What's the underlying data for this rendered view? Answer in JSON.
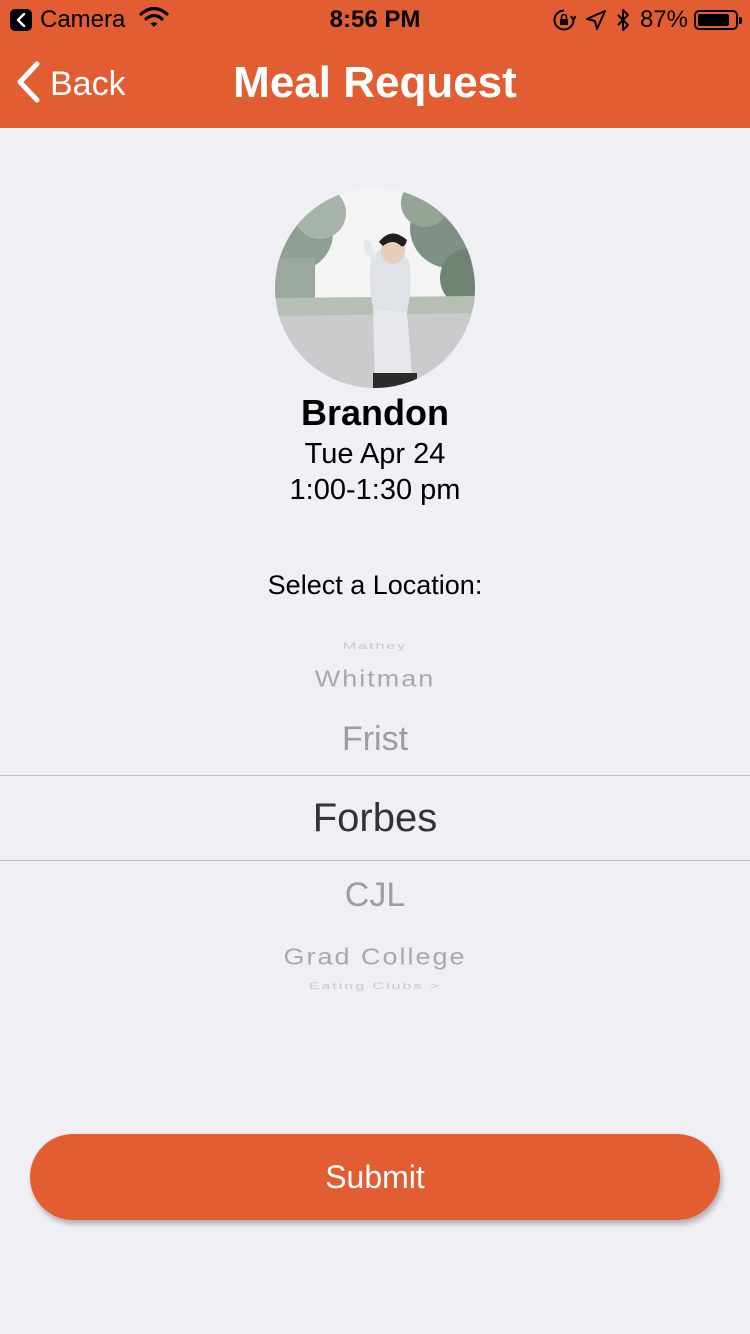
{
  "status_bar": {
    "back_app": "Camera",
    "time": "8:56 PM",
    "battery_percent": "87%",
    "battery_level": 0.87,
    "icons": [
      "wifi-icon",
      "orientation-lock-icon",
      "location-arrow-icon",
      "bluetooth-icon",
      "battery-icon"
    ]
  },
  "nav": {
    "back_label": "Back",
    "title": "Meal Request"
  },
  "profile": {
    "name": "Brandon",
    "date": "Tue Apr 24",
    "time": "1:00-1:30 pm"
  },
  "location": {
    "label": "Select a Location:",
    "options": [
      "Mathey",
      "Whitman",
      "Frist",
      "Forbes",
      "CJL",
      "Grad College",
      "Eating Clubs >"
    ],
    "selected": "Forbes"
  },
  "submit": {
    "label": "Submit"
  },
  "colors": {
    "accent": "#e35d33",
    "background": "#efeff4"
  }
}
